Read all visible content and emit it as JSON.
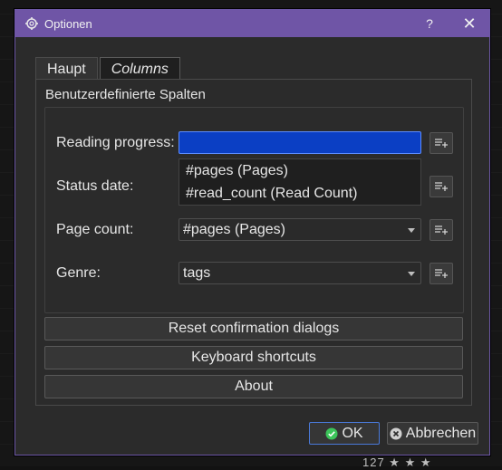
{
  "window": {
    "title": "Optionen",
    "help_label": "?",
    "close_label": "✕"
  },
  "tabs": [
    {
      "label": "Haupt",
      "active": false
    },
    {
      "label": "Columns",
      "active": true
    }
  ],
  "group": {
    "title": "Benutzerdefinierte Spalten",
    "rows": [
      {
        "label": "Reading progress:",
        "value": "",
        "open": true
      },
      {
        "label": "Status date:",
        "value": ""
      },
      {
        "label": "Page count:",
        "value": "#pages (Pages)"
      },
      {
        "label": "Genre:",
        "value": "tags"
      }
    ],
    "dropdown_options": [
      "#pages (Pages)",
      "#read_count (Read Count)"
    ]
  },
  "buttons": {
    "reset": "Reset confirmation dialogs",
    "shortcuts": "Keyboard shortcuts",
    "about": "About",
    "ok": "OK",
    "cancel": "Abbrechen"
  },
  "background": {
    "footer_text": "127   ★ ★ ★"
  },
  "colors": {
    "titlebar": "#6f55a6",
    "selection": "#0b3fc4",
    "ok_icon": "#3cc45a",
    "cancel_icon": "#d0d0d0"
  }
}
